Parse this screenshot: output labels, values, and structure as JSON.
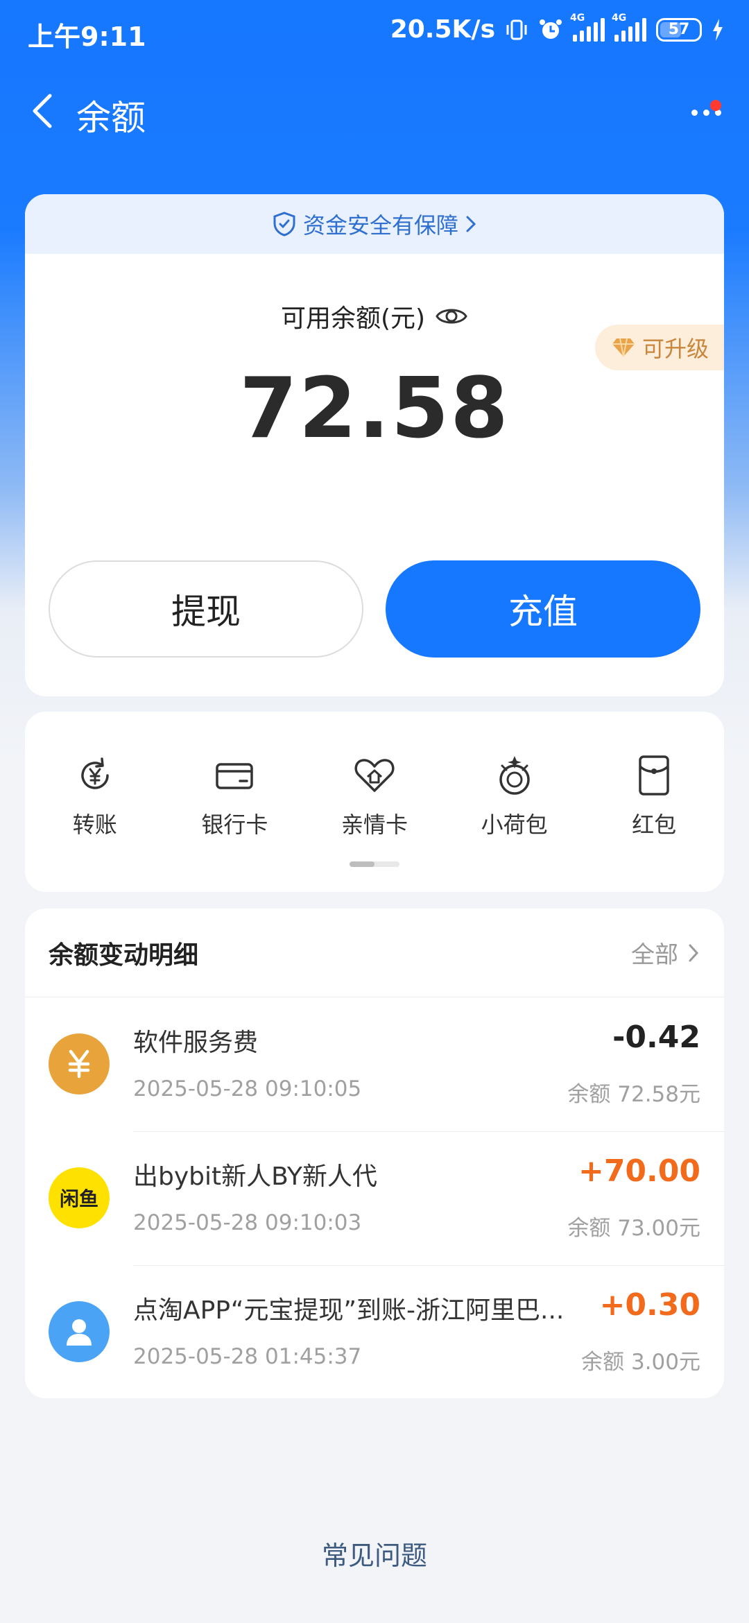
{
  "status_bar": {
    "time": "上午9:11",
    "network_speed": "20.5K/s",
    "sim1_label": "4G",
    "sim2_label": "4G",
    "battery": "57"
  },
  "header": {
    "title": "余额"
  },
  "balance_card": {
    "security_text": "资金安全有保障",
    "balance_label": "可用余额(元)",
    "balance_amount": "72.58",
    "upgrade_text": "可升级",
    "withdraw_label": "提现",
    "recharge_label": "充值"
  },
  "actions": [
    {
      "label": "转账",
      "icon": "transfer-icon"
    },
    {
      "label": "银行卡",
      "icon": "bank-card-icon"
    },
    {
      "label": "亲情卡",
      "icon": "family-card-icon"
    },
    {
      "label": "小荷包",
      "icon": "small-pouch-icon"
    },
    {
      "label": "红包",
      "icon": "red-packet-icon"
    }
  ],
  "transactions": {
    "title": "余额变动明细",
    "all_label": "全部",
    "items": [
      {
        "name": "软件服务费",
        "time": "2025-05-28 09:10:05",
        "amount": "-0.42",
        "balance": "余额 72.58元",
        "avatar": "yuan-avatar-icon",
        "avatar_color": "#e8a33a"
      },
      {
        "name": "出bybit新人BY新人代",
        "time": "2025-05-28 09:10:03",
        "amount": "+70.00",
        "balance": "余额 73.00元",
        "avatar": "xianyu-logo",
        "avatar_color": "#ffe100",
        "avatar_text": "闲鱼"
      },
      {
        "name": "点淘APP“元宝提现”到账-浙江阿里巴...",
        "time": "2025-05-28 01:45:37",
        "amount": "+0.30",
        "balance": "余额 3.00元",
        "avatar": "user-avatar-icon",
        "avatar_color": "#4aa3f5"
      }
    ]
  },
  "faq_label": "常见问题",
  "colors": {
    "primary": "#1677ff",
    "positive_amount": "#f26b1d",
    "upgrade": "#c9863b"
  }
}
